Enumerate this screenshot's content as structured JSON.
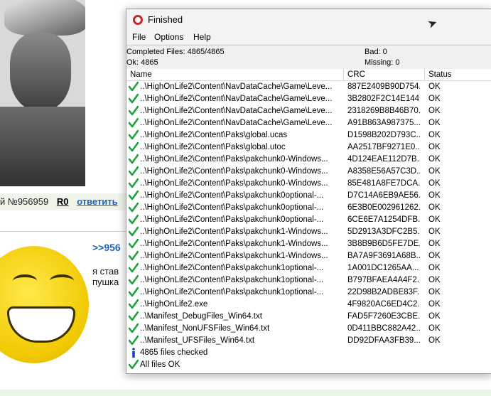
{
  "background": {
    "post_meta": {
      "number": "й №956959",
      "r0": "R0",
      "reply": "ответить"
    },
    "quote": ">>956",
    "text_line1": "я став",
    "text_line2": "пушка"
  },
  "window": {
    "title": "Finished",
    "menu": [
      "File",
      "Options",
      "Help"
    ],
    "stats": {
      "completed": "Completed Files: 4865/4865",
      "ok": "Ok: 4865",
      "bad": "Bad: 0",
      "missing": "Missing: 0"
    },
    "columns": {
      "name": "Name",
      "crc": "CRC",
      "status": "Status"
    },
    "rows": [
      {
        "name": "..\\HighOnLife2\\Content\\NavDataCache\\Game\\Leve...",
        "crc": "887E2409B90D754...",
        "status": "OK"
      },
      {
        "name": "..\\HighOnLife2\\Content\\NavDataCache\\Game\\Leve...",
        "crc": "3B2802F2C14E144...",
        "status": "OK"
      },
      {
        "name": "..\\HighOnLife2\\Content\\NavDataCache\\Game\\Leve...",
        "crc": "2318269B8B46B70...",
        "status": "OK"
      },
      {
        "name": "..\\HighOnLife2\\Content\\NavDataCache\\Game\\Leve...",
        "crc": "A91B863A987375...",
        "status": "OK"
      },
      {
        "name": "..\\HighOnLife2\\Content\\Paks\\global.ucas",
        "crc": "D1598B202D793C...",
        "status": "OK"
      },
      {
        "name": "..\\HighOnLife2\\Content\\Paks\\global.utoc",
        "crc": "AA2517BF9271E0...",
        "status": "OK"
      },
      {
        "name": "..\\HighOnLife2\\Content\\Paks\\pakchunk0-Windows...",
        "crc": "4D124EAE112D7B...",
        "status": "OK"
      },
      {
        "name": "..\\HighOnLife2\\Content\\Paks\\pakchunk0-Windows...",
        "crc": "A8358E56A57C3D...",
        "status": "OK"
      },
      {
        "name": "..\\HighOnLife2\\Content\\Paks\\pakchunk0-Windows...",
        "crc": "85E481A8FE7DCA...",
        "status": "OK"
      },
      {
        "name": "..\\HighOnLife2\\Content\\Paks\\pakchunk0optional-...",
        "crc": "D7C14A6EB9AE56...",
        "status": "OK"
      },
      {
        "name": "..\\HighOnLife2\\Content\\Paks\\pakchunk0optional-...",
        "crc": "6E3B0E002961262...",
        "status": "OK"
      },
      {
        "name": "..\\HighOnLife2\\Content\\Paks\\pakchunk0optional-...",
        "crc": "6CE6E7A1254DFB...",
        "status": "OK"
      },
      {
        "name": "..\\HighOnLife2\\Content\\Paks\\pakchunk1-Windows...",
        "crc": "5D2913A3DFC2B5...",
        "status": "OK"
      },
      {
        "name": "..\\HighOnLife2\\Content\\Paks\\pakchunk1-Windows...",
        "crc": "3B8B9B6D5FE7DE...",
        "status": "OK"
      },
      {
        "name": "..\\HighOnLife2\\Content\\Paks\\pakchunk1-Windows...",
        "crc": "BA7A9F3691A68B...",
        "status": "OK"
      },
      {
        "name": "..\\HighOnLife2\\Content\\Paks\\pakchunk1optional-...",
        "crc": "1A001DC1265AA...",
        "status": "OK"
      },
      {
        "name": "..\\HighOnLife2\\Content\\Paks\\pakchunk1optional-...",
        "crc": "B797BFAEA4A4F2...",
        "status": "OK"
      },
      {
        "name": "..\\HighOnLife2\\Content\\Paks\\pakchunk1optional-...",
        "crc": "22D98B2ADBE83F...",
        "status": "OK"
      },
      {
        "name": "..\\HighOnLife2.exe",
        "crc": "4F9820AC6ED4C2...",
        "status": "OK"
      },
      {
        "name": "..\\Manifest_DebugFiles_Win64.txt",
        "crc": "FAD5F7260E3CBE...",
        "status": "OK"
      },
      {
        "name": "..\\Manifest_NonUFSFiles_Win64.txt",
        "crc": "0D411BBC882A42...",
        "status": "OK"
      },
      {
        "name": "..\\Manifest_UFSFiles_Win64.txt",
        "crc": "DD92DFAA3FB39...",
        "status": "OK"
      }
    ],
    "summary": [
      {
        "icon": "info",
        "text": "4865 files checked"
      },
      {
        "icon": "check",
        "text": "All files OK"
      }
    ]
  },
  "colors": {
    "check": "#1fa33a",
    "info": "#1a3fbf",
    "link": "#1f63b5"
  }
}
